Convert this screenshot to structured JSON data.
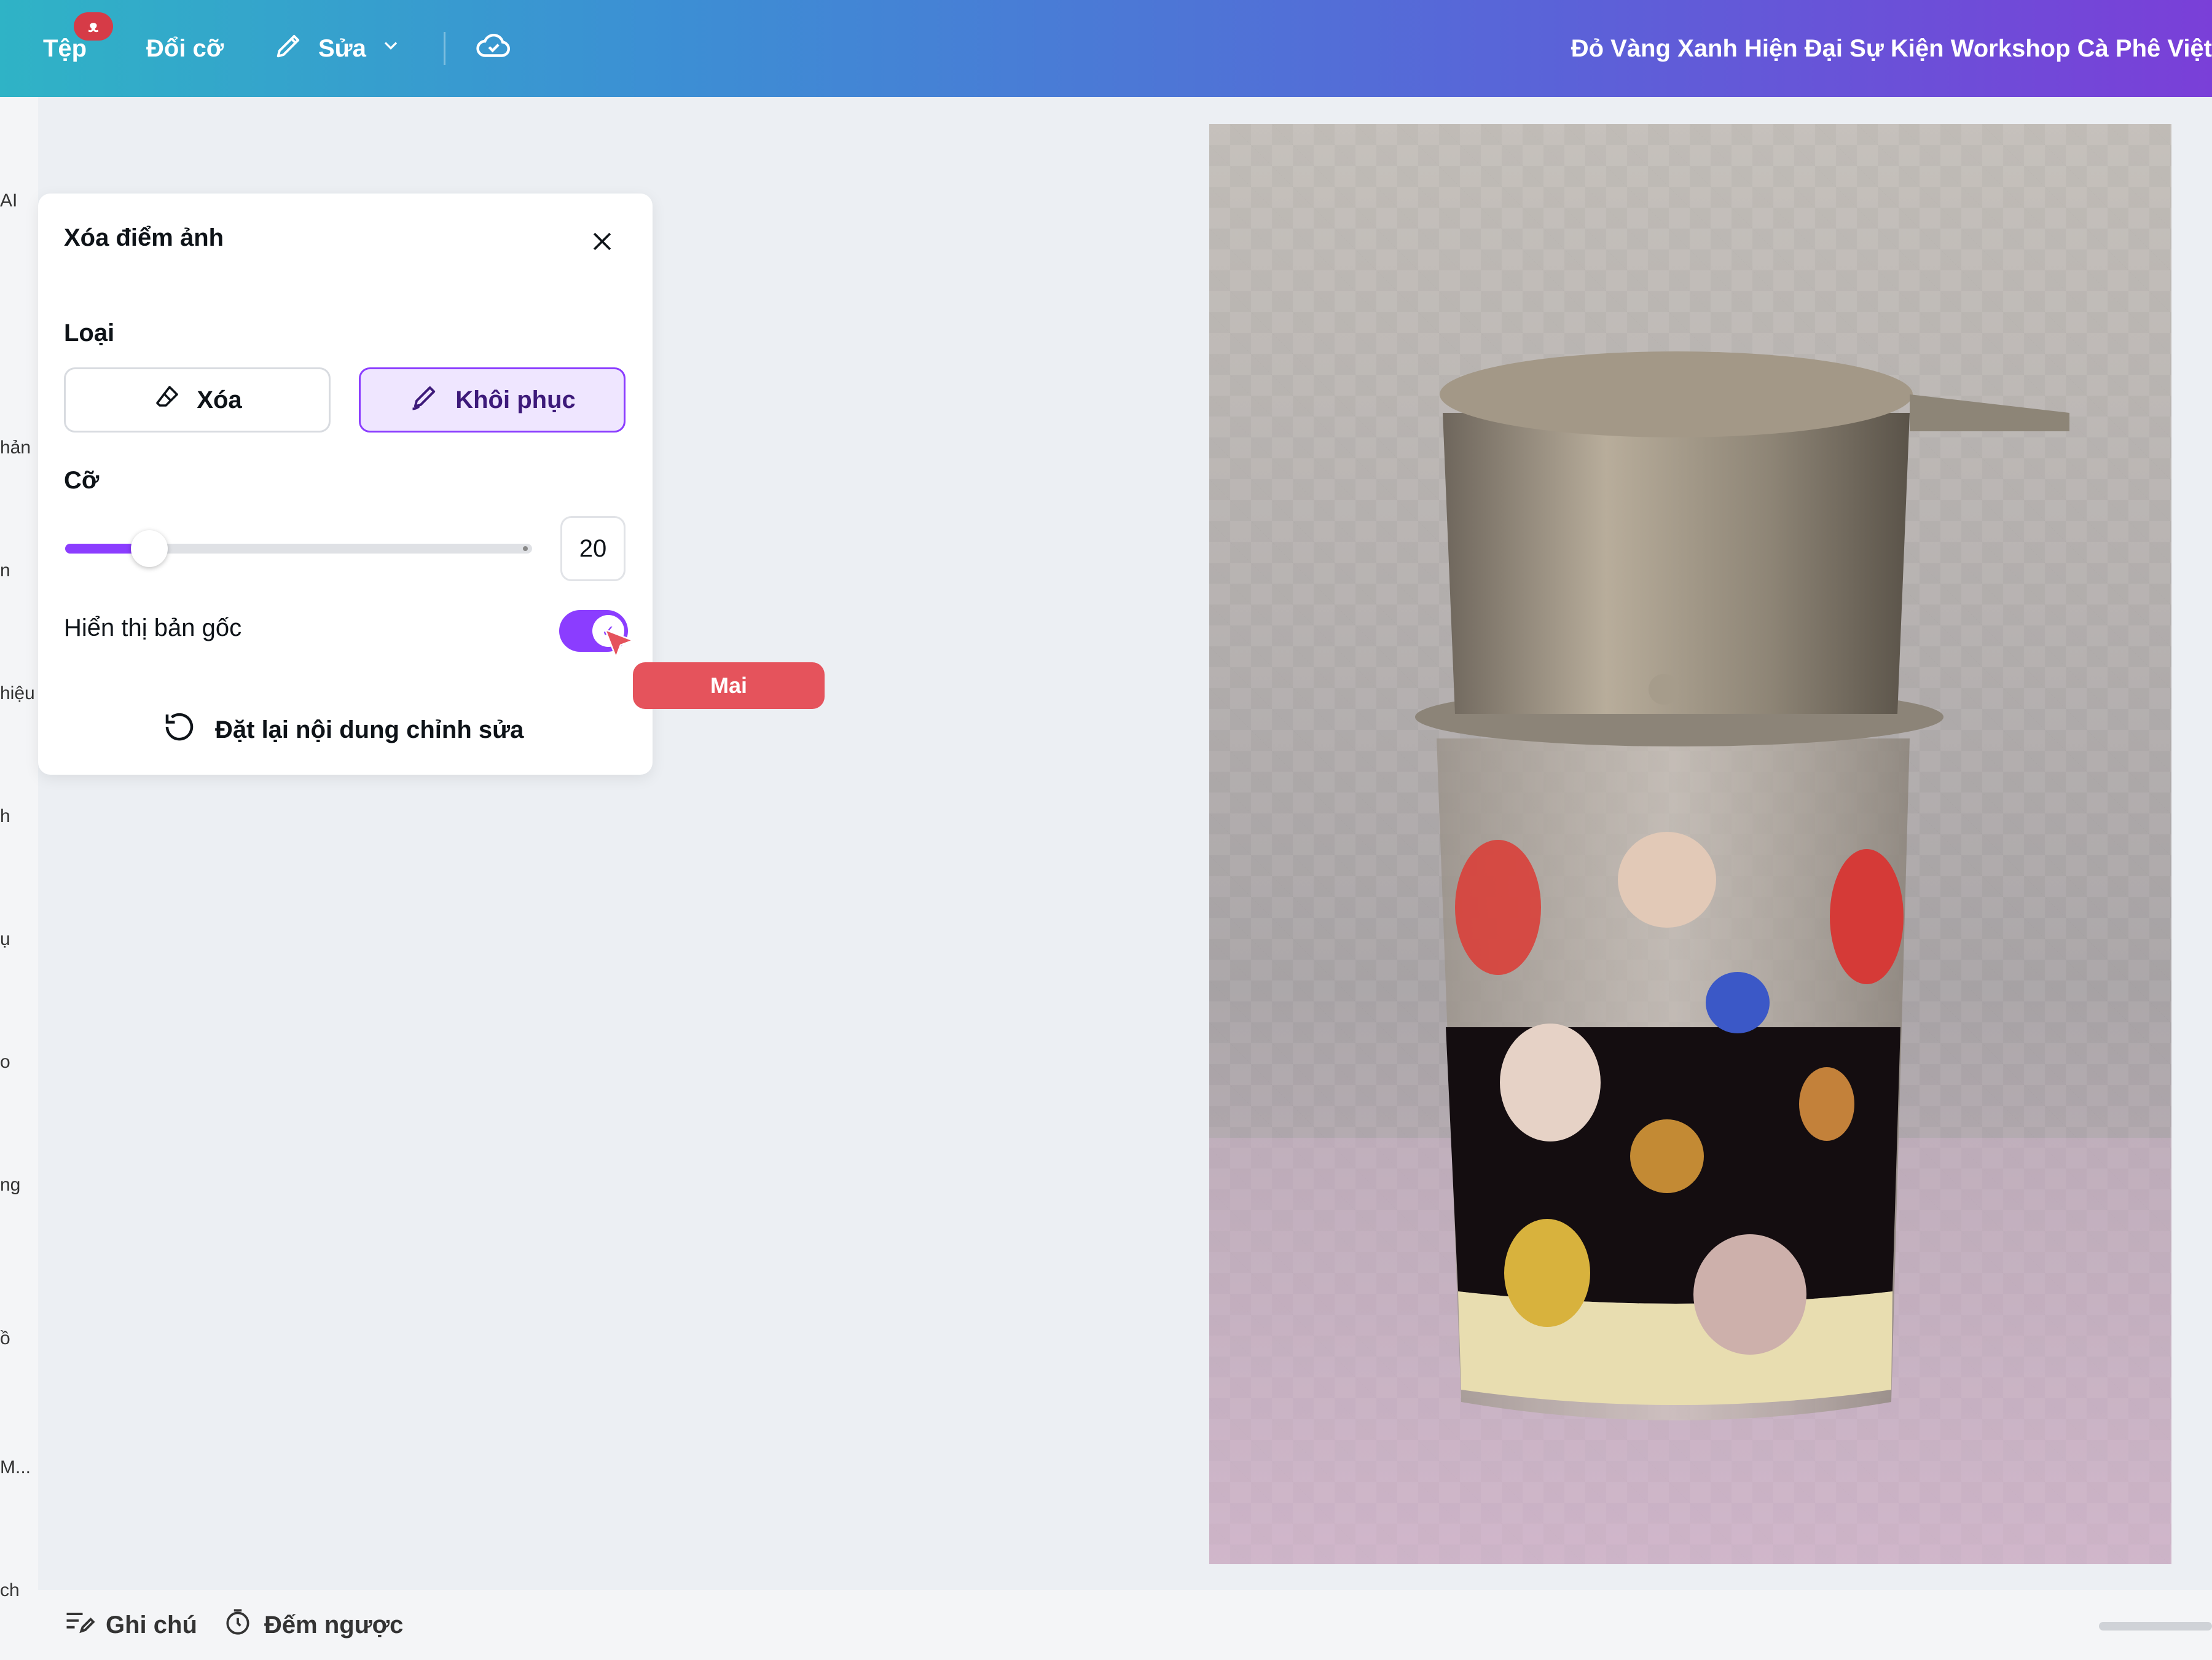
{
  "topbar": {
    "file_label": "Tệp",
    "file_badge": "ᴥ",
    "resize_label": "Đổi cỡ",
    "edit_label": "Sửa",
    "doc_title": "Đỏ Vàng Xanh Hiện Đại Sự Kiện Workshop Cà Phê Việt"
  },
  "rail": {
    "labels": [
      "AI",
      "hản",
      "n",
      "hiệu",
      "h",
      "ụ",
      "o",
      "ng",
      "ồ",
      "M...",
      "ch"
    ]
  },
  "panel": {
    "title": "Xóa điểm ảnh",
    "type_label": "Loại",
    "erase_label": "Xóa",
    "restore_label": "Khôi phục",
    "size_label": "Cỡ",
    "size_value": "20",
    "slider_fraction": 0.18,
    "show_original_label": "Hiển thị bản gốc",
    "show_original_on": true,
    "reset_label": "Đặt lại nội dung chỉnh sửa"
  },
  "collaborator": {
    "name": "Mai",
    "color": "#e5535c"
  },
  "bottombar": {
    "notes_label": "Ghi chú",
    "timer_label": "Đếm ngược"
  },
  "colors": {
    "accent": "#8b3dff",
    "accent_light": "#efe6ff"
  }
}
